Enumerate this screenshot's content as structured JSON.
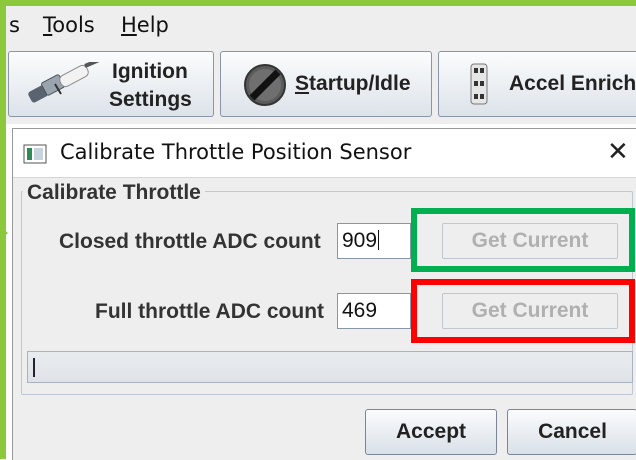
{
  "menu": {
    "items": [
      {
        "label": "s"
      },
      {
        "label": "Tools"
      },
      {
        "label": "Help"
      }
    ]
  },
  "toolbar": {
    "ignition_line1": "Ignition",
    "ignition_line2": "Settings",
    "startup_label": "Startup/Idle",
    "accel_label": "Accel Enrich"
  },
  "dialog": {
    "title": "Calibrate Throttle Position Sensor",
    "group_title": "Calibrate Throttle",
    "closed_label": "Closed throttle ADC count",
    "closed_value": "909",
    "full_label": "Full throttle ADC count",
    "full_value": "469",
    "get_current_label": "Get Current",
    "accept_label": "Accept",
    "cancel_label": "Cancel",
    "close_glyph": "✕"
  },
  "colors": {
    "highlight_closed": "#00b050",
    "highlight_full": "#ff0000",
    "accent": "#8cc83c"
  }
}
